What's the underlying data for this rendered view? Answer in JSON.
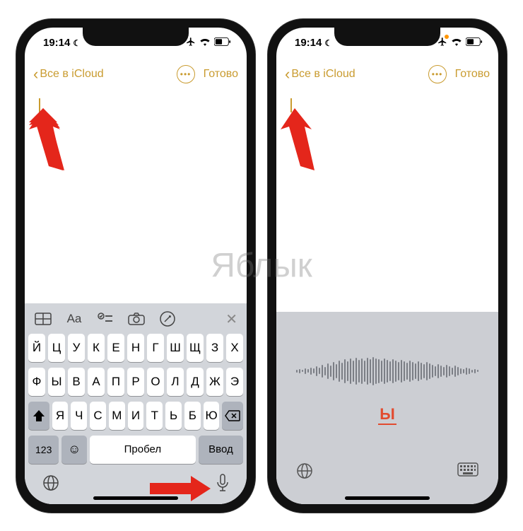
{
  "watermark": "Яблык",
  "status": {
    "time": "19:14",
    "moon": "☾"
  },
  "nav": {
    "back_label": "Все в iCloud",
    "done_label": "Готово"
  },
  "toolbar_icons": {
    "table": "table-icon",
    "aa": "Aa",
    "checklist": "checklist-icon",
    "camera": "camera-icon",
    "pencil": "markup-icon"
  },
  "keyboard": {
    "row1": [
      "Й",
      "Ц",
      "У",
      "К",
      "Е",
      "Н",
      "Г",
      "Ш",
      "Щ",
      "З",
      "Х"
    ],
    "row2": [
      "Ф",
      "Ы",
      "В",
      "А",
      "П",
      "Р",
      "О",
      "Л",
      "Д",
      "Ж",
      "Э"
    ],
    "row3": [
      "Я",
      "Ч",
      "С",
      "М",
      "И",
      "Т",
      "Ь",
      "Б",
      "Ю"
    ],
    "num_label": "123",
    "space_label": "Пробел",
    "enter_label": "Ввод"
  },
  "dictation": {
    "letter": "Ы"
  }
}
